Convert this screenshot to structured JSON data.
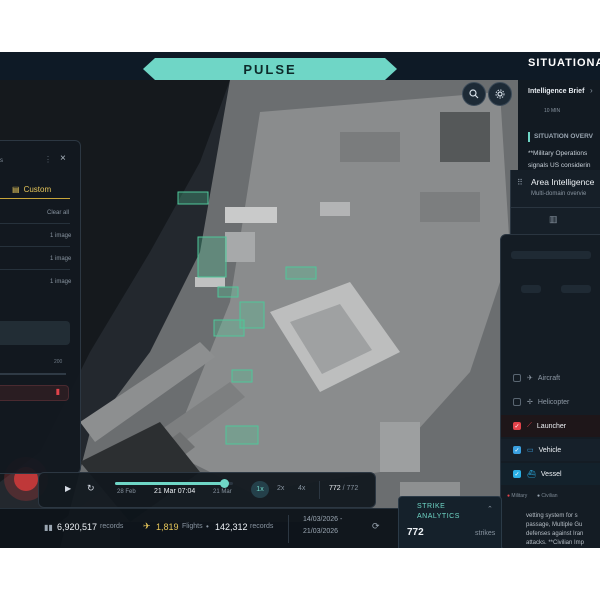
{
  "header": {
    "app_title": "PULSE",
    "right_panel_title": "SITUATIONA"
  },
  "map_controls": {
    "search_icon": "search-icon",
    "settings_icon": "settings-icon"
  },
  "right_panel": {
    "brief_title": "Intelligence Brief",
    "brief_time": "10 MIN",
    "section_title": "SITUATION OVERV",
    "text_line_1": "**Military Operations",
    "text_line_2": "signals US considerin",
    "area_title": "Area Intelligence",
    "area_subtitle": "Multi-domain overvie",
    "bottom_text": [
      "vetting system for s",
      "passage, Multiple Gu",
      "defenses against Iran",
      "attacks. **Civilian Imp"
    ]
  },
  "layers": {
    "items": [
      {
        "label": "Aircraft",
        "checked": false,
        "color": "#5a6672"
      },
      {
        "label": "Helicopter",
        "checked": false,
        "color": "#5a6672"
      },
      {
        "label": "Launcher",
        "checked": true,
        "color": "#e2434b"
      },
      {
        "label": "Vehicle",
        "checked": true,
        "color": "#3aa0e0"
      },
      {
        "label": "Vessel",
        "checked": true,
        "color": "#2bb0e6"
      }
    ],
    "legend_military": "Military",
    "legend_civilian": "Civilian"
  },
  "left_panel": {
    "tab_custom": "Custom",
    "clear_all": "Clear all",
    "rows": [
      "1 image",
      "1 image",
      "1 image"
    ],
    "small_value": "200"
  },
  "timeline": {
    "start_date": "28 Feb",
    "current": "21 Mar 07:04",
    "end_date": "21 Mar",
    "speeds": [
      "1x",
      "2x",
      "4x"
    ],
    "active_speed": "1x",
    "count_current": "772",
    "count_total": "772",
    "progress": 0.92
  },
  "statusbar": {
    "records_value": "6,920,517",
    "records_label": "records",
    "flights_value": "1,819",
    "flights_label": "Flights",
    "records2_value": "142,312",
    "records2_label": "records",
    "date_from": "14/03/2026 -",
    "date_to": "21/03/2026"
  },
  "strike": {
    "title_line1": "STRIKE",
    "title_line2": "ANALYTICS",
    "value": "772",
    "unit": "strikes"
  },
  "colors": {
    "accent": "#6fd6c6",
    "gold": "#e6c65a",
    "launcher": "#e2434b",
    "vessel": "#2bb0e6"
  }
}
